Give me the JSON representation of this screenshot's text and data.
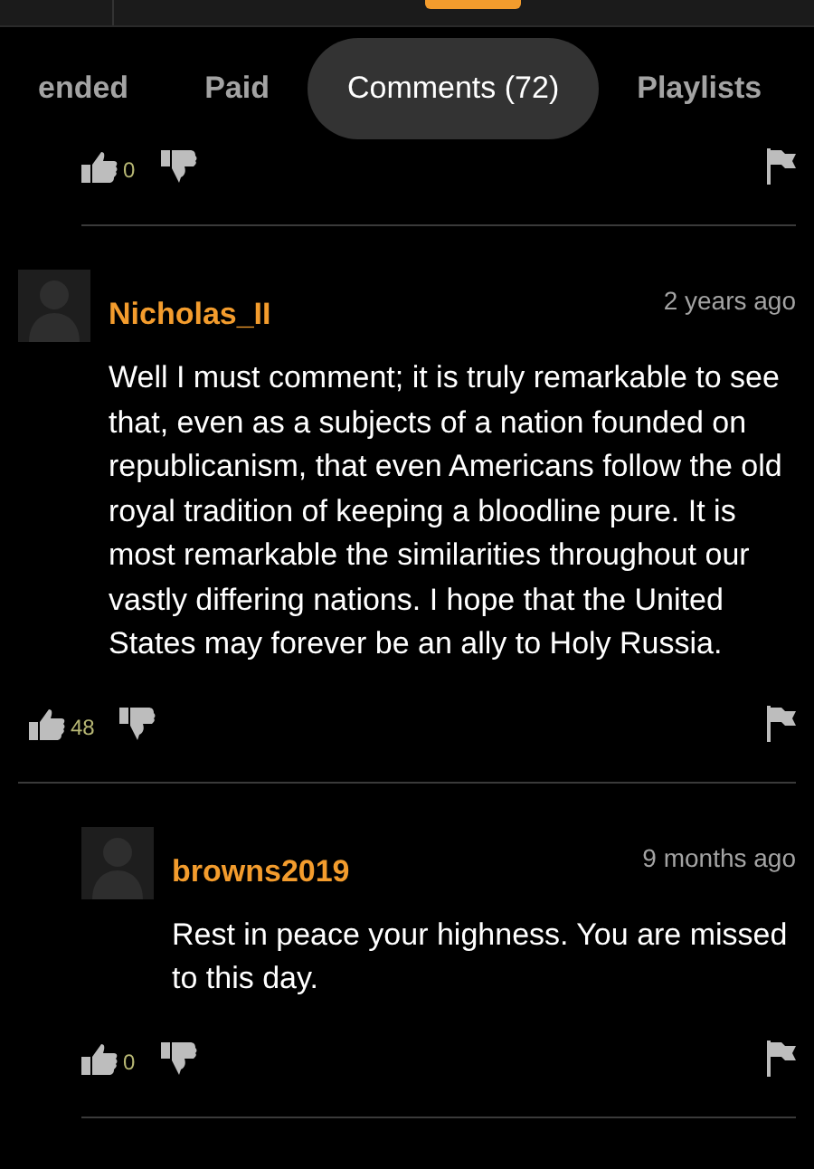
{
  "tabs": [
    {
      "label": "ended",
      "selected": false
    },
    {
      "label": "Paid",
      "selected": false
    },
    {
      "label": "Comments (72)",
      "selected": true
    },
    {
      "label": "Playlists",
      "selected": false
    }
  ],
  "partial_comment": {
    "reply": true,
    "likes": "0"
  },
  "comments": [
    {
      "reply": false,
      "username": "Nicholas_II",
      "time": "2 years ago",
      "text": "Well I must comment; it is truly remarkable to see that, even as a subjects of a nation founded on republicanism, that even Americans follow the old royal tradition of keeping a bloodline pure. It is most remarkable the similarities throughout our vastly differing nations. I hope that the United States may forever be an ally to Holy Russia.",
      "likes": "48"
    },
    {
      "reply": true,
      "username": "browns2019",
      "time": "9 months ago",
      "text": "Rest in peace your highness. You are missed to this day.",
      "likes": "0"
    }
  ]
}
